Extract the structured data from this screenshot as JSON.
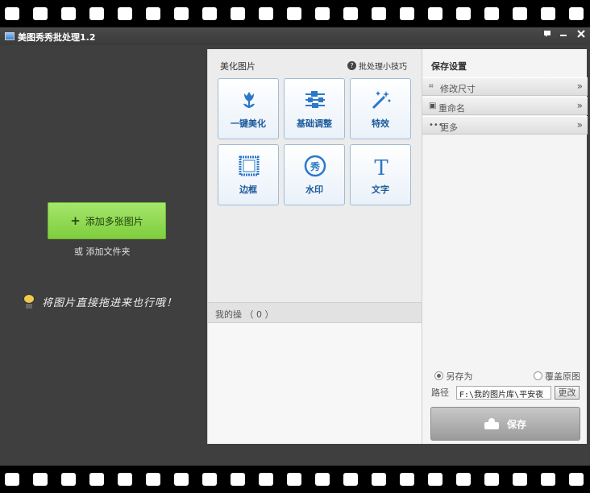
{
  "app": {
    "title": "美图秀秀批处理1.2"
  },
  "window_controls": {
    "menu_icon": "feedback-icon",
    "minimize_icon": "minimize-icon",
    "close_icon": "close-icon"
  },
  "left": {
    "add_button_label": "添加多张图片",
    "add_folder_label": "或 添加文件夹",
    "drag_hint": "将图片直接拖进来也行哦！"
  },
  "beautify": {
    "title": "美化图片",
    "tips_label": "批处理小技巧",
    "tools": [
      {
        "label": "一键美化",
        "icon": "tulip-icon"
      },
      {
        "label": "基础调整",
        "icon": "sliders-icon"
      },
      {
        "label": "特效",
        "icon": "magic-wand-icon"
      },
      {
        "label": "边框",
        "icon": "frame-icon"
      },
      {
        "label": "水印",
        "icon": "watermark-icon"
      },
      {
        "label": "文字",
        "icon": "text-icon"
      }
    ],
    "mine_label": "我的操 （ 0 ）"
  },
  "save_settings": {
    "title": "保存设置",
    "sections": [
      {
        "label": "修改尺寸",
        "icon": "crop-icon"
      },
      {
        "label": "重命名",
        "icon": "rename-icon"
      },
      {
        "label": "更多",
        "icon": "more-icon"
      }
    ],
    "option_save_as": "另存为",
    "option_overwrite": "覆盖原图",
    "selected_option": "另存为",
    "path_label": "路径",
    "path_value": "F:\\我的图片库\\平安夜",
    "change_button": "更改",
    "save_button": "保存"
  }
}
